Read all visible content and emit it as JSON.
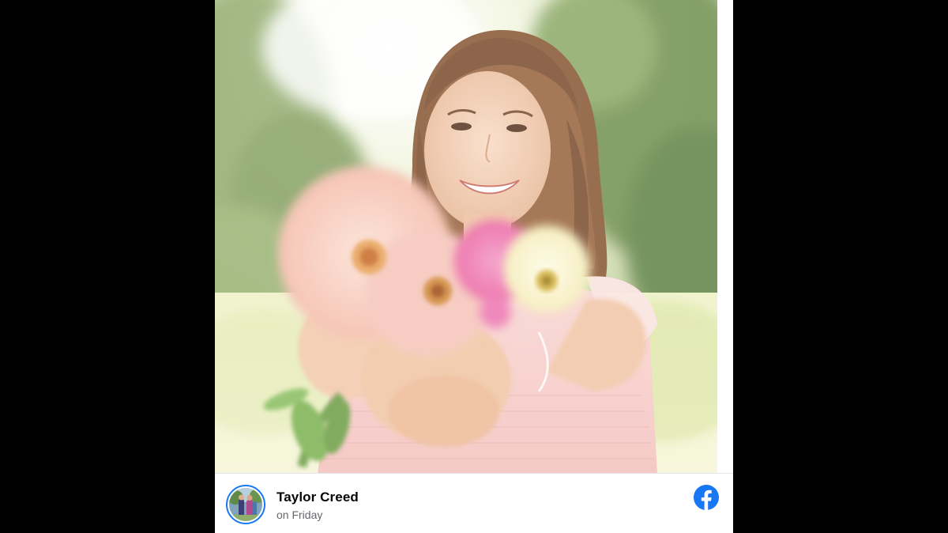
{
  "post": {
    "author_name": "Taylor Creed",
    "timestamp": "on Friday",
    "photo_alt": "Smiling woman holding out a bouquet of zinnias in a sunny field",
    "avatar_alt": "Taylor Creed profile photo"
  },
  "icons": {
    "platform": "facebook-icon"
  },
  "colors": {
    "background": "#000000",
    "card": "#ffffff",
    "facebook_blue": "#1877f2",
    "name_text": "#050505",
    "meta_text": "#65676b"
  }
}
